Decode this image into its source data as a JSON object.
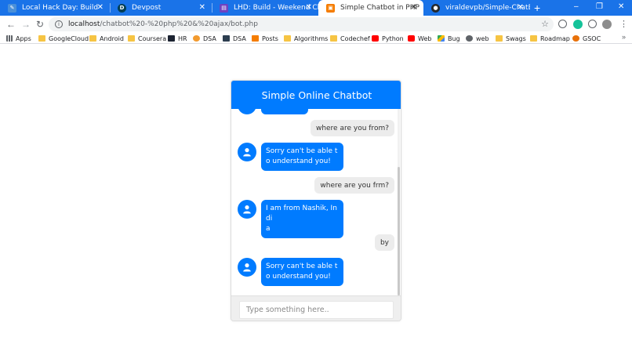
{
  "browser": {
    "tabs": [
      {
        "title": "Local Hack Day: Build",
        "favicon": "local-hack-day-icon",
        "color": "#1a73e8",
        "active": false
      },
      {
        "title": "Devpost",
        "favicon": "devpost-icon",
        "color": "#003e54",
        "active": false
      },
      {
        "title": "LHD: Build - Weekend Challenge",
        "favicon": "lhd-icon",
        "color": "#6f42c1",
        "active": false
      },
      {
        "title": "Simple Chatbot in PHP",
        "favicon": "php-chatbot-icon",
        "color": "#f57c00",
        "active": true
      },
      {
        "title": "viraldevpb/Simple-ChatBot: Th",
        "favicon": "github-icon",
        "color": "#24292e",
        "active": false
      }
    ],
    "new_tab": "+",
    "window_controls": {
      "minimize": "–",
      "maximize": "❐",
      "close": "✕"
    },
    "nav": {
      "back": "←",
      "forward": "→",
      "reload": "↻"
    },
    "address": {
      "host": "localhost",
      "path": "/chatbot%20-%20php%20&%20ajax/bot.php"
    },
    "bookmark_star": "☆",
    "bookmarks": [
      {
        "label": "Apps",
        "icon": "apps-grid-icon",
        "kind": "apps"
      },
      {
        "label": "GoogleCloud",
        "icon": "folder-icon",
        "kind": "folder"
      },
      {
        "label": "Android",
        "icon": "folder-icon",
        "kind": "folder"
      },
      {
        "label": "Coursera",
        "icon": "folder-icon",
        "kind": "folder"
      },
      {
        "label": "HR",
        "icon": "hackerrank-icon",
        "kind": "hr"
      },
      {
        "label": "DSA",
        "icon": "dsa-icon",
        "kind": "dsa1"
      },
      {
        "label": "DSA",
        "icon": "dsa-book-icon",
        "kind": "dsa2"
      },
      {
        "label": "Posts",
        "icon": "blogger-icon",
        "kind": "posts"
      },
      {
        "label": "Algorithms",
        "icon": "folder-icon",
        "kind": "folder"
      },
      {
        "label": "Codechef",
        "icon": "folder-icon",
        "kind": "folder"
      },
      {
        "label": "Python",
        "icon": "youtube-icon",
        "kind": "yt"
      },
      {
        "label": "Web",
        "icon": "youtube-icon",
        "kind": "yt"
      },
      {
        "label": "Bug",
        "icon": "google-drive-icon",
        "kind": "drive"
      },
      {
        "label": "web",
        "icon": "globe-icon",
        "kind": "web2"
      },
      {
        "label": "Swags",
        "icon": "folder-icon",
        "kind": "folder"
      },
      {
        "label": "Roadmap",
        "icon": "folder-icon",
        "kind": "folder"
      },
      {
        "label": "GSOC",
        "icon": "gsoc-icon",
        "kind": "gsoc"
      }
    ],
    "bookmarks_more": "»"
  },
  "chat": {
    "header_title": "Simple Online Chatbot",
    "accent_color": "#007bff",
    "messages": [
      {
        "from": "user",
        "text": "where are you from?"
      },
      {
        "from": "bot",
        "text": "Sorry can't be able to understand you!"
      },
      {
        "from": "user",
        "text": "where are you frm?"
      },
      {
        "from": "bot",
        "text": "I am from Nashik, Indi\na"
      },
      {
        "from": "user",
        "text": "by"
      },
      {
        "from": "bot",
        "text": "Sorry can't be able to understand you!"
      }
    ],
    "input_placeholder": "Type something here.."
  }
}
